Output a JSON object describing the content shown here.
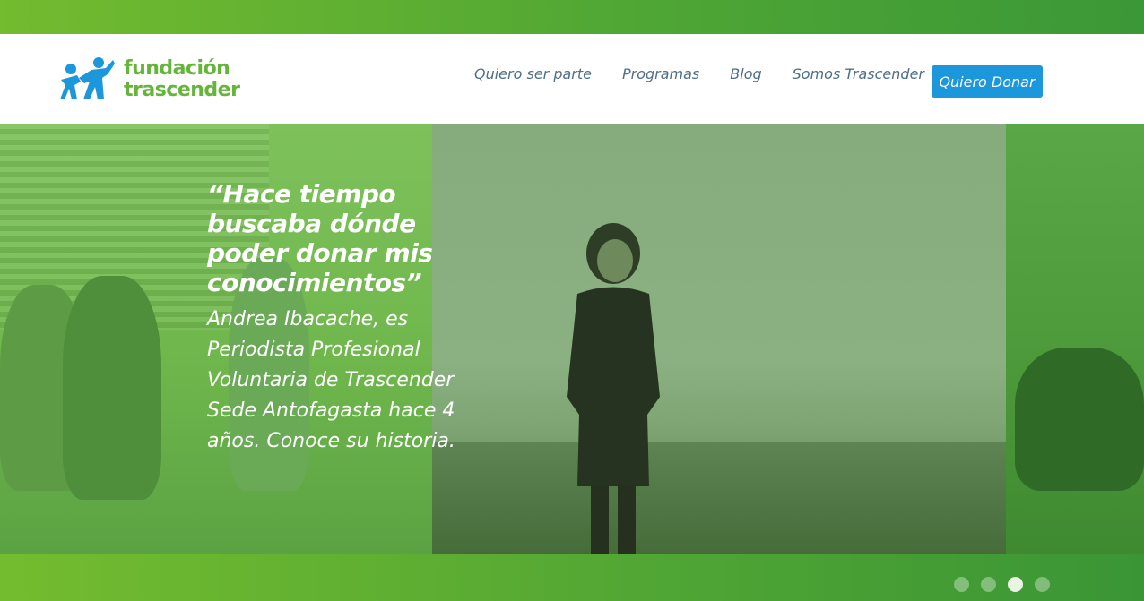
{
  "brand": {
    "line1": "fundación",
    "line2": "trascender",
    "color": "#64b53a",
    "icon": "people-icon"
  },
  "nav": {
    "items": [
      {
        "label": "Quiero ser parte"
      },
      {
        "label": "Programas"
      },
      {
        "label": "Blog"
      },
      {
        "label": "Somos Trascender"
      }
    ],
    "donate_label": "Quiero Donar",
    "donate_color": "#1d97dc"
  },
  "hero": {
    "quote": "“Hace tiempo buscaba dónde poder donar mis conocimientos”",
    "caption": "Andrea Ibacache, es Periodista Profesional Voluntaria de Trascender Sede Antofagasta hace 4 años. Conoce su historia.",
    "overlay_color": "#6fb74c"
  },
  "slider": {
    "total": 4,
    "active_index": 2
  },
  "colors": {
    "stripe": "#4da535",
    "nav_text": "#4f6f86"
  }
}
